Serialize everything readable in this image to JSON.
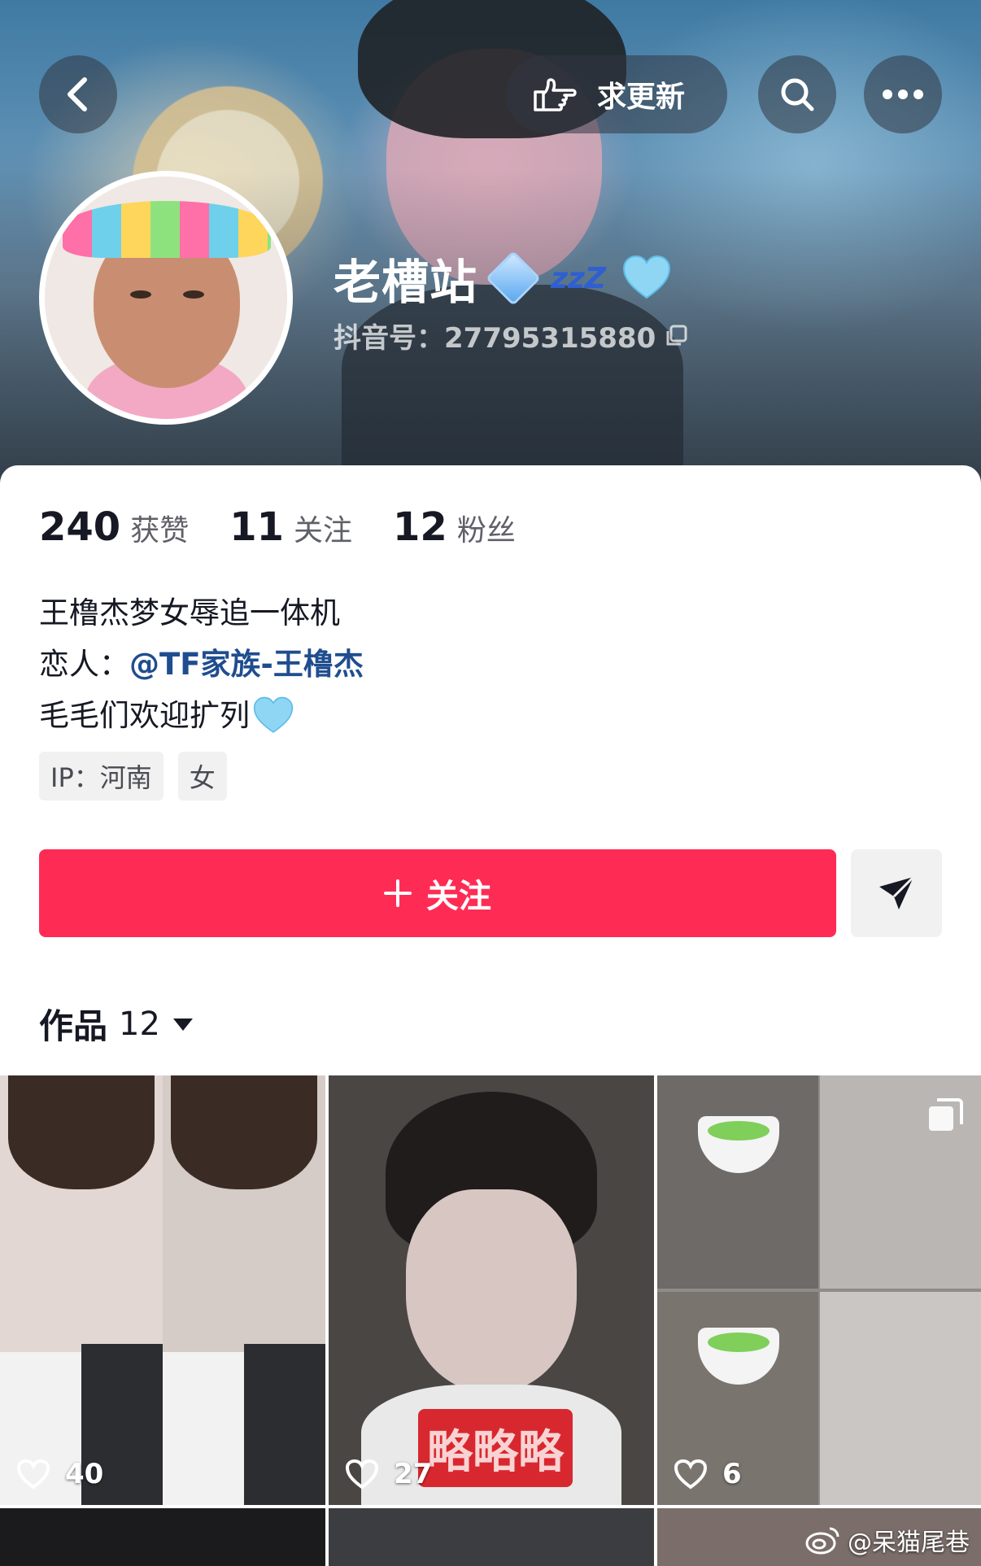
{
  "header": {
    "request_update_label": "求更新"
  },
  "profile": {
    "name": "老槽站",
    "zzz": "zzZ",
    "douyin_id": "抖音号：27795315880"
  },
  "stats": [
    {
      "value": "240",
      "label": "获赞"
    },
    {
      "value": "11",
      "label": "关注"
    },
    {
      "value": "12",
      "label": "粉丝"
    }
  ],
  "bio": {
    "line1": "王橹杰梦女辱追一体机",
    "line2_prefix": "恋人：",
    "line2_mention": "@TF家族-王橹杰",
    "line3": "毛毛们欢迎扩列"
  },
  "tags": [
    "IP：河南",
    "女"
  ],
  "actions": {
    "follow_label": "关注"
  },
  "works": {
    "label": "作品",
    "count": "12"
  },
  "grid": [
    {
      "likes": "40",
      "caption": ""
    },
    {
      "likes": "27",
      "caption": "略略略"
    },
    {
      "likes": "6",
      "caption": ""
    }
  ],
  "watermark": "@呆猫尾巷",
  "colors": {
    "accent": "#fe2c55",
    "mention": "#1f4d8f"
  }
}
